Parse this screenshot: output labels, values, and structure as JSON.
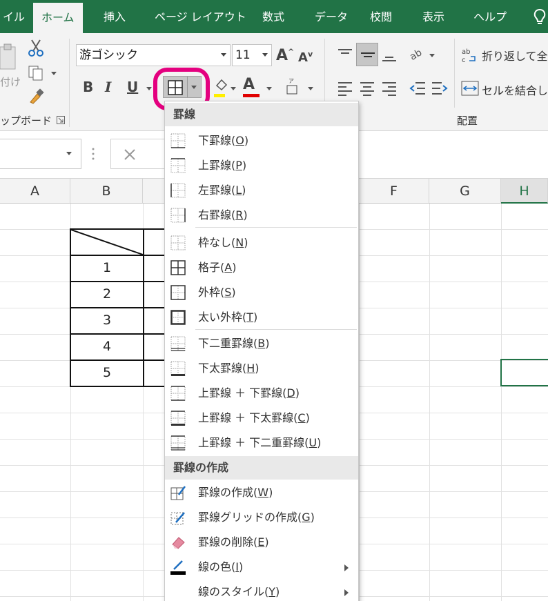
{
  "tabs": [
    {
      "label": "イル",
      "active": false
    },
    {
      "label": "ホーム",
      "active": true
    },
    {
      "label": "挿入",
      "active": false
    },
    {
      "label": "ページ レイアウト",
      "active": false
    },
    {
      "label": "数式",
      "active": false
    },
    {
      "label": "データ",
      "active": false
    },
    {
      "label": "校閲",
      "active": false
    },
    {
      "label": "表示",
      "active": false
    },
    {
      "label": "ヘルプ",
      "active": false
    }
  ],
  "ribbon": {
    "paste_label": "付け",
    "clipboard_label": "ップボード",
    "font_name": "游ゴシック",
    "font_size": "11",
    "bold": "B",
    "italic": "I",
    "underline": "U",
    "align_group_label": "配置",
    "wrap_text": "折り返して全体",
    "merge_cells": "セルを結合して",
    "font_color_letter": "A",
    "grow_font": "A",
    "shrink_font": "A"
  },
  "columns": [
    "A",
    "B",
    "C",
    "D",
    "E",
    "F",
    "G",
    "H"
  ],
  "table_rows": [
    "1",
    "2",
    "3",
    "4",
    "5"
  ],
  "colors": {
    "excel_green": "#217346",
    "highlight_pink": "#e4007f",
    "font_color": "#e00000",
    "fill_color": "#ffef00"
  },
  "menu": {
    "section_borders": "罫線",
    "section_draw": "罫線の作成",
    "items": [
      {
        "label": "下罫線(",
        "key": "O",
        "end": ")",
        "icon": "bottom-border-icon"
      },
      {
        "label": "上罫線(",
        "key": "P",
        "end": ")",
        "icon": "top-border-icon"
      },
      {
        "label": "左罫線(",
        "key": "L",
        "end": ")",
        "icon": "left-border-icon"
      },
      {
        "label": "右罫線(",
        "key": "R",
        "end": ")",
        "icon": "right-border-icon"
      },
      {
        "label": "枠なし(",
        "key": "N",
        "end": ")",
        "icon": "no-border-icon"
      },
      {
        "label": "格子(",
        "key": "A",
        "end": ")",
        "icon": "all-borders-icon"
      },
      {
        "label": "外枠(",
        "key": "S",
        "end": ")",
        "icon": "outside-borders-icon"
      },
      {
        "label": "太い外枠(",
        "key": "T",
        "end": ")",
        "icon": "thick-outside-border-icon"
      },
      {
        "label": "下二重罫線(",
        "key": "B",
        "end": ")",
        "icon": "bottom-double-border-icon"
      },
      {
        "label": "下太罫線(",
        "key": "H",
        "end": ")",
        "icon": "thick-bottom-border-icon"
      },
      {
        "label": "上罫線 ＋ 下罫線(",
        "key": "D",
        "end": ")",
        "icon": "top-bottom-border-icon"
      },
      {
        "label": "上罫線 ＋ 下太罫線(",
        "key": "C",
        "end": ")",
        "icon": "top-thick-bottom-border-icon"
      },
      {
        "label": "上罫線 ＋ 下二重罫線(",
        "key": "U",
        "end": ")",
        "icon": "top-double-bottom-border-icon"
      }
    ],
    "draw_items": [
      {
        "label": "罫線の作成(",
        "key": "W",
        "end": ")",
        "icon": "draw-border-icon"
      },
      {
        "label": "罫線グリッドの作成(",
        "key": "G",
        "end": ")",
        "icon": "draw-border-grid-icon"
      },
      {
        "label": "罫線の削除(",
        "key": "E",
        "end": ")",
        "icon": "eraser-icon"
      },
      {
        "label": "線の色(",
        "key": "I",
        "end": ")",
        "icon": "line-color-icon"
      },
      {
        "label": "線のスタイル(",
        "key": "Y",
        "end": ")",
        "icon": "line-style-icon"
      }
    ]
  }
}
